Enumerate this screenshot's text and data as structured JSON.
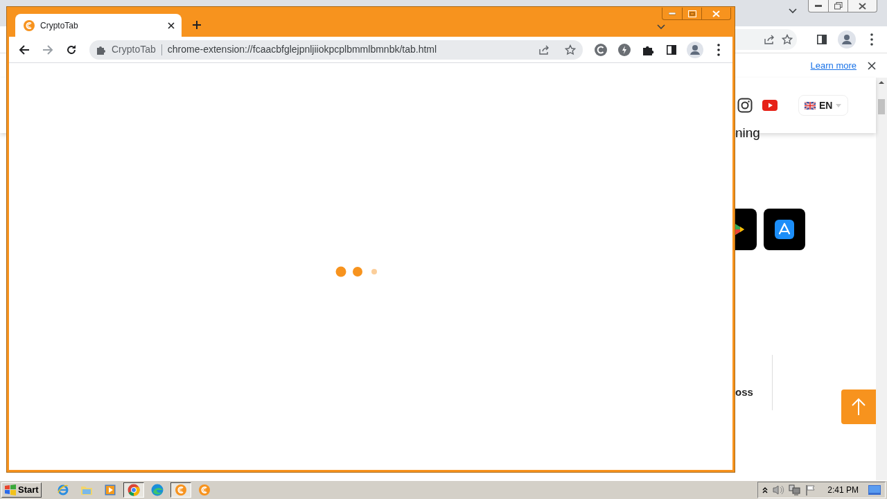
{
  "background_window": {
    "infobar": {
      "link": "Learn more"
    },
    "page": {
      "heading_fragment": "ning",
      "language": "EN",
      "label_fragment": "oss"
    }
  },
  "popup_window": {
    "tabs": [
      {
        "title": "CryptoTab",
        "selected": true
      }
    ],
    "address_bar": {
      "site_chip": "CryptoTab",
      "url": "chrome-extension://fcaacbfglejpnljiiokpcplbmmlbmnbk/tab.html"
    }
  },
  "taskbar": {
    "start": "Start",
    "items": [
      {
        "kind": "ie",
        "selected": false
      },
      {
        "kind": "explorer",
        "selected": false
      },
      {
        "kind": "media",
        "selected": false
      },
      {
        "kind": "chrome",
        "selected": true
      },
      {
        "kind": "edge",
        "selected": false
      },
      {
        "kind": "cryptotab",
        "selected": true
      },
      {
        "kind": "cryptotab",
        "selected": false
      }
    ],
    "clock": "2:41 PM"
  }
}
